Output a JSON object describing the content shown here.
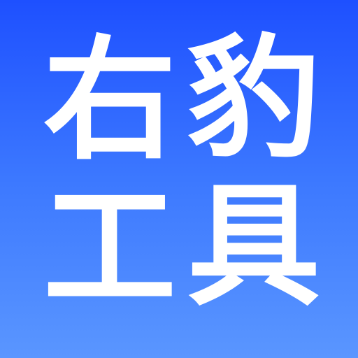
{
  "app_icon": {
    "characters": [
      "右",
      "豹",
      "工",
      "具"
    ],
    "colors": {
      "background_top": "#1E50FF",
      "background_mid": "#3C78FF",
      "background_bottom": "#5A96FF",
      "text": "#FFFFFF"
    }
  }
}
